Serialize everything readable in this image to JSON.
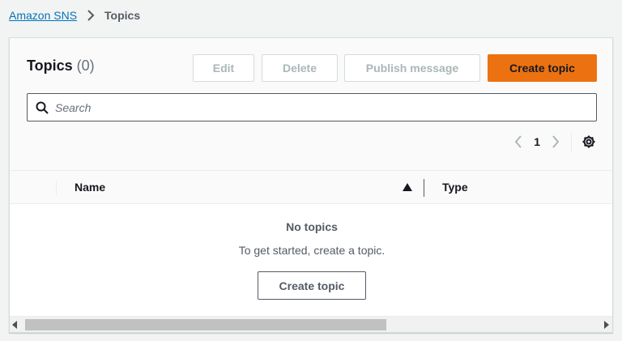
{
  "breadcrumb": {
    "root": "Amazon SNS",
    "current": "Topics"
  },
  "header": {
    "title": "Topics",
    "count": "(0)"
  },
  "toolbar": {
    "edit_label": "Edit",
    "delete_label": "Delete",
    "publish_label": "Publish message",
    "create_label": "Create topic"
  },
  "search": {
    "placeholder": "Search",
    "value": ""
  },
  "pagination": {
    "current_page": "1"
  },
  "table": {
    "columns": [
      "Name",
      "Type"
    ],
    "sort_column": "Name",
    "sort_direction": "ascending"
  },
  "empty_state": {
    "title": "No topics",
    "description": "To get started, create a topic.",
    "button_label": "Create topic"
  },
  "icons": {
    "breadcrumb_separator": "chevron-right-icon",
    "search": "search-icon",
    "prev": "chevron-left-icon",
    "next": "chevron-right-icon",
    "settings": "gear-icon",
    "sort": "sort-ascending-icon"
  },
  "colors": {
    "link": "#0073bb",
    "primary": "#ec7211",
    "disabled_text": "#aab7b8",
    "text": "#16191f",
    "muted": "#545b64"
  }
}
